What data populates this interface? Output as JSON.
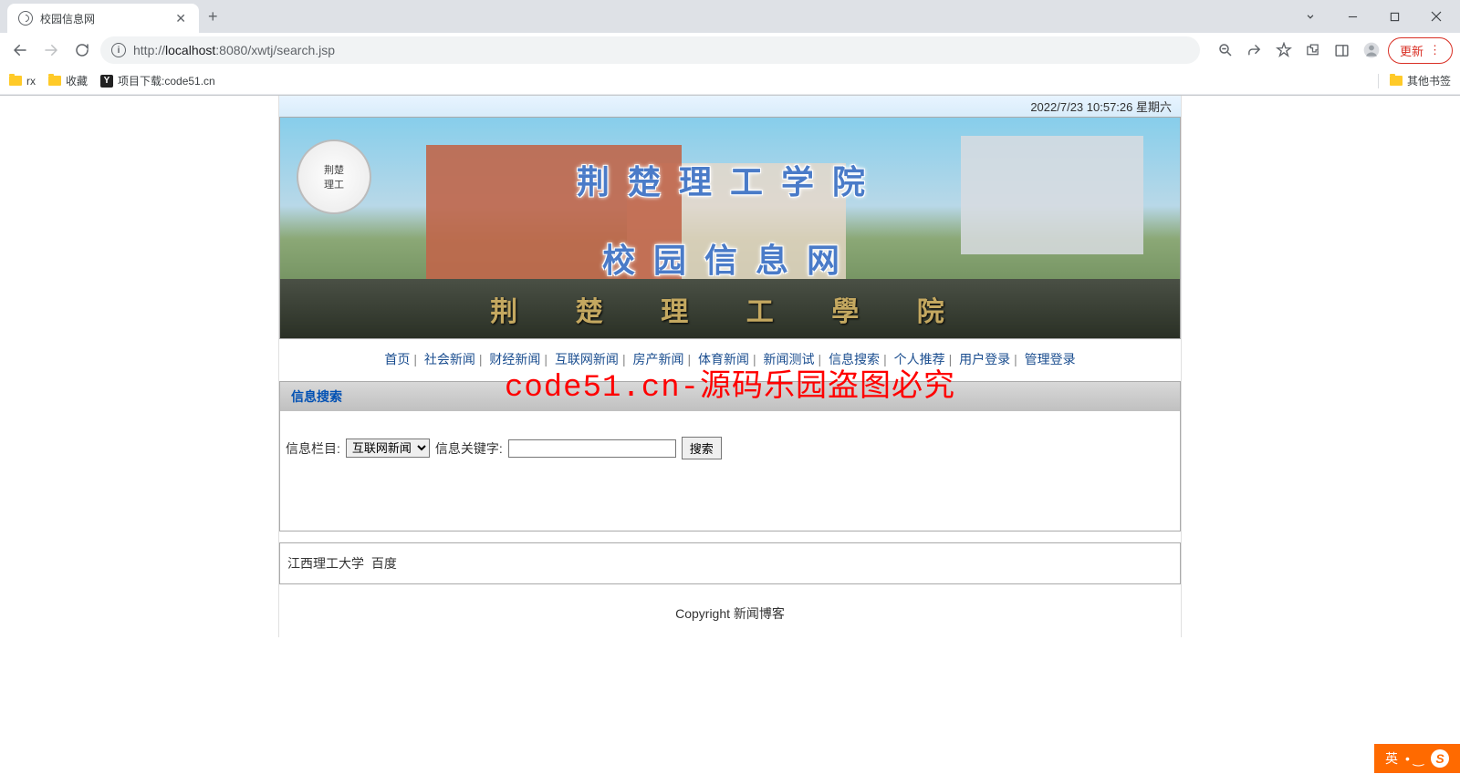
{
  "browser": {
    "tab_title": "校园信息网",
    "url_prefix": "http://",
    "url_host": "localhost",
    "url_path": ":8080/xwtj/search.jsp",
    "update_label": "更新",
    "bookmarks": [
      {
        "type": "folder",
        "label": "rx"
      },
      {
        "type": "folder",
        "label": "收藏"
      },
      {
        "type": "y",
        "label": "项目下载:code51.cn"
      }
    ],
    "other_bookmarks_label": "其他书签"
  },
  "page": {
    "datetime": "2022/7/23 10:57:26  星期六",
    "banner_title1": "荆楚理工学院",
    "banner_title2": "校园信息网",
    "banner_sign": "荆 楚 理 工 學 院",
    "nav": [
      "首页",
      "社会新闻",
      "财经新闻",
      "互联网新闻",
      "房产新闻",
      "体育新闻",
      "新闻测试",
      "信息搜索",
      "个人推荐",
      "用户登录",
      "管理登录"
    ],
    "search": {
      "panel_title": "信息搜索",
      "label_category": "信息栏目:",
      "label_keyword": "信息关键字:",
      "selected_category": "互联网新闻",
      "keyword_value": "",
      "button_label": "搜索"
    },
    "footer_links": [
      "江西理工大学",
      "百度"
    ],
    "copyright": "Copyright 新闻博客",
    "watermark": "code51.cn-源码乐园盗图必究"
  },
  "ime": {
    "lang": "英"
  }
}
